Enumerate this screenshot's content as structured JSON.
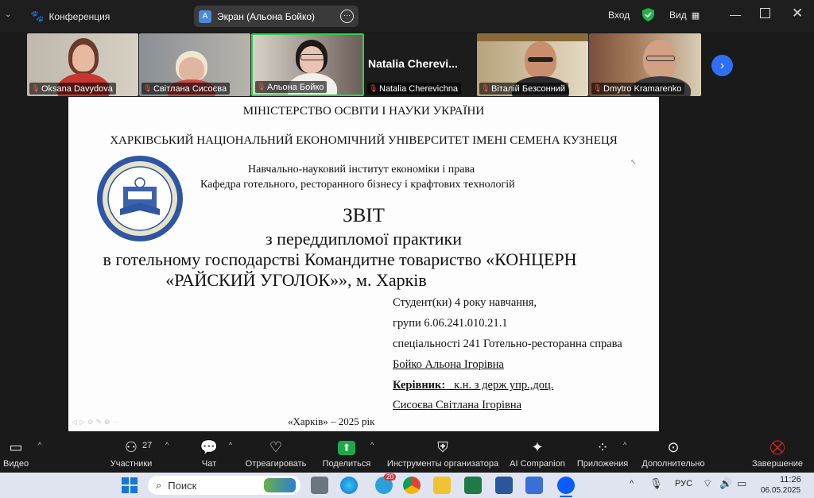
{
  "topbar": {
    "app_title": "Конференция",
    "share_badge": "А",
    "share_label": "Экран (Альона Бойко)",
    "login_label": "Вход",
    "view_label": "Вид"
  },
  "gallery": [
    {
      "name": "Oksana Davydova"
    },
    {
      "name": "Світлана Сисоєва"
    },
    {
      "name": "Альона Бойко"
    },
    {
      "name": "Natalia Cherevichna",
      "display": "Natalia Cherevi..."
    },
    {
      "name": "Віталій Безсонний"
    },
    {
      "name": "Dmytro Kramarenko"
    }
  ],
  "slide": {
    "ministry": "МІНІСТЕРСТВО ОСВІТИ І НАУКИ УКРАЇНИ",
    "university": "ХАРКІВСЬКИЙ НАЦІОНАЛЬНИЙ ЕКОНОМІЧНИЙ УНІВЕРСИТЕТ ІМЕНІ СЕМЕНА КУЗНЕЦЯ",
    "institute": "Навчально-науковий інститут економіки і права",
    "department": "Кафедра готельного, ресторанного бізнесу і крафтових технологій",
    "title": "ЗВІТ",
    "subtitle1": "з переддипломої практики",
    "subtitle2": "в  готельному господарстві Командитне товариство «КОНЦЕРН",
    "subtitle3": "«РАЙСКИЙ УГОЛОК»», м. Харків",
    "student": "Студент(ки) 4 року навчання,",
    "group": "групи 6.06.241.010.21.1",
    "specialty": "спеціальності 241 Готельно-ресторанна справа",
    "student_name": "Бойко Альона Ігорівна",
    "supervisor_label": "Керівник:",
    "supervisor_title": "   к.н. з держ упр.,доц.",
    "supervisor_name": "Сисоєва Світлана Ігорівна",
    "city_year": "«Харків»  – 2025 рік"
  },
  "toolbar": {
    "video": "Видео",
    "participants": "Участники",
    "participants_count": "27",
    "chat": "Чат",
    "react": "Отреагировать",
    "share": "Поделиться",
    "host_tools": "Инструменты организатора",
    "companion": "AI Companion",
    "apps": "Приложения",
    "more": "Дополнительно",
    "end": "Завершение"
  },
  "taskbar": {
    "search_placeholder": "Поиск",
    "language": "РУС",
    "time": "11:26",
    "date": "06.05.2025",
    "telegram_badge": "20"
  },
  "colors": {
    "active_speaker_border": "#2dd34a",
    "share_green": "#1fa84a",
    "end_red": "#e02828",
    "zoom_blue": "#0b5cff"
  }
}
